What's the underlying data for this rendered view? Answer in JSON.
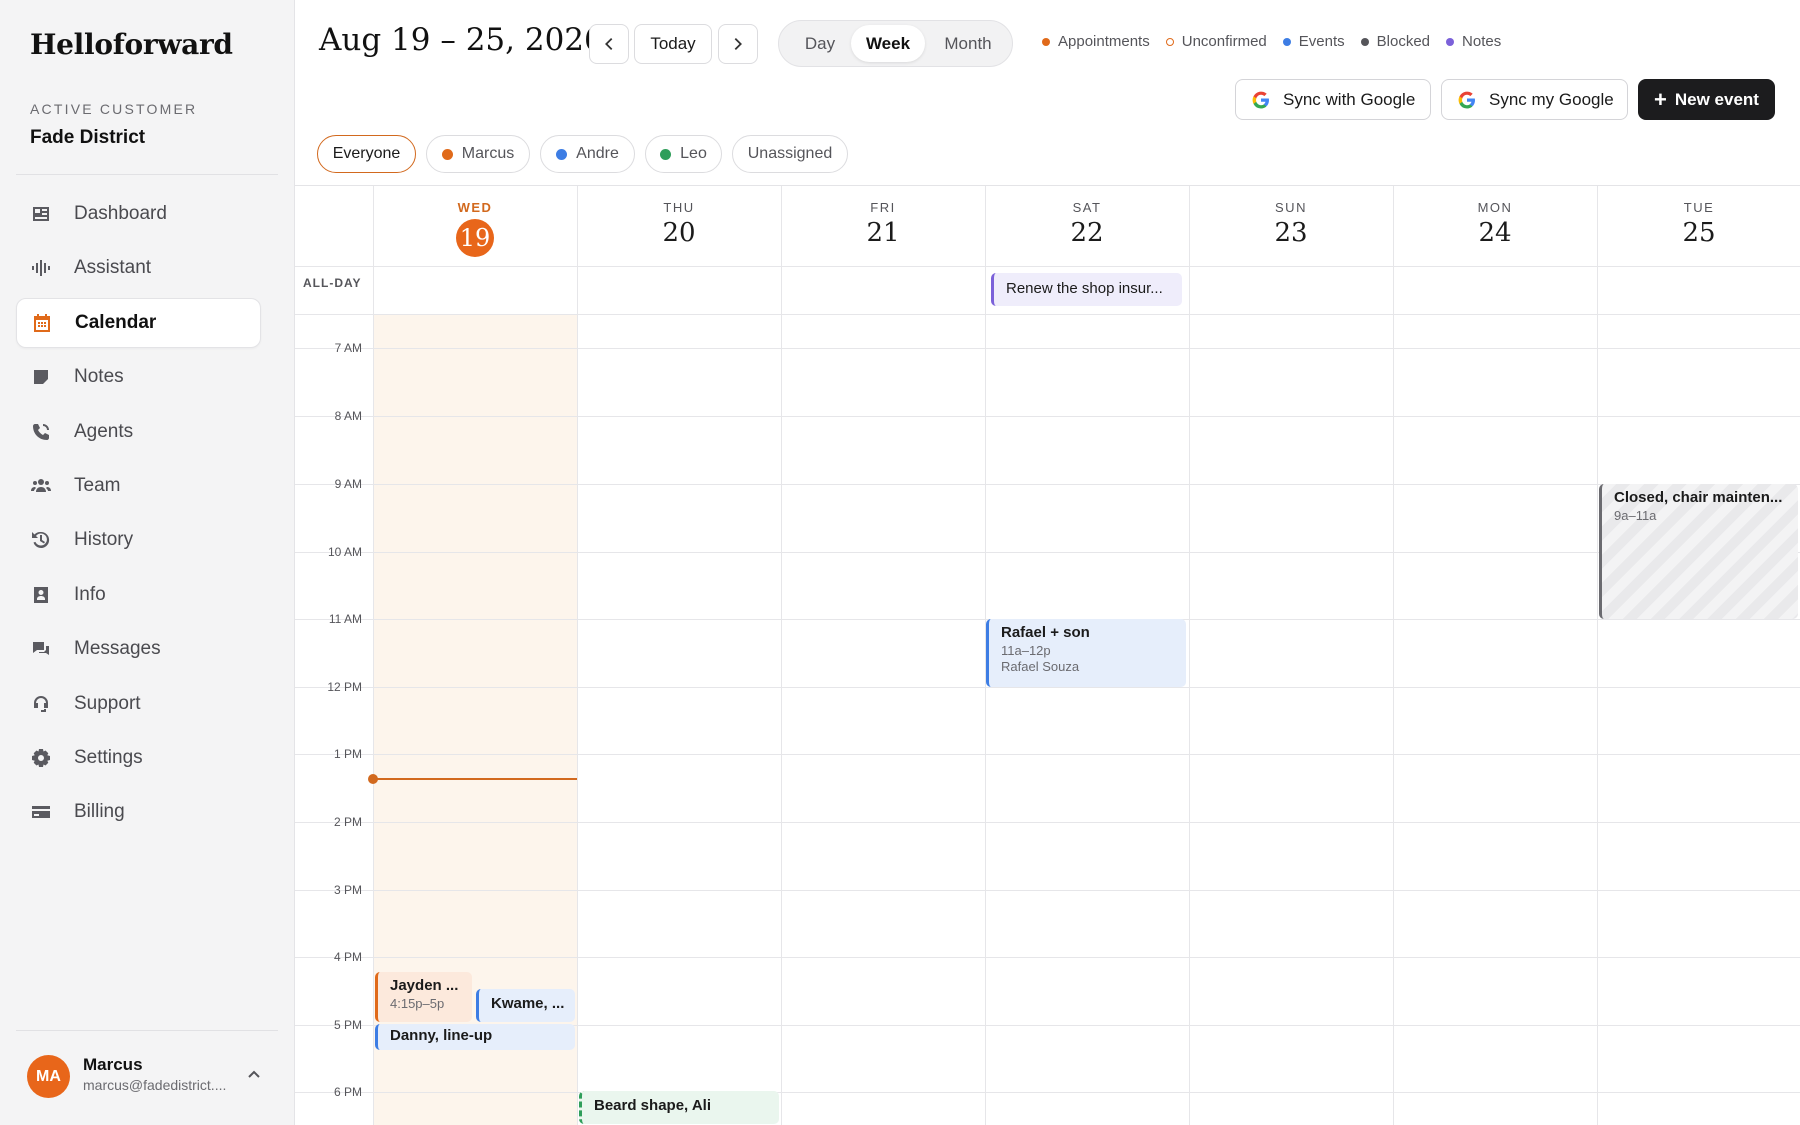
{
  "app": {
    "brand": "Helloforward"
  },
  "customer": {
    "label": "ACTIVE CUSTOMER",
    "name": "Fade District"
  },
  "sidebar": {
    "items": [
      {
        "label": "Dashboard",
        "icon": "dashboard-icon"
      },
      {
        "label": "Assistant",
        "icon": "waveform-icon"
      },
      {
        "label": "Calendar",
        "icon": "calendar-icon",
        "active": true
      },
      {
        "label": "Notes",
        "icon": "note-icon"
      },
      {
        "label": "Agents",
        "icon": "phone-icon"
      },
      {
        "label": "Team",
        "icon": "team-icon"
      },
      {
        "label": "History",
        "icon": "history-icon"
      },
      {
        "label": "Info",
        "icon": "contact-card-icon"
      },
      {
        "label": "Messages",
        "icon": "chat-icon"
      },
      {
        "label": "Support",
        "icon": "headset-icon"
      },
      {
        "label": "Settings",
        "icon": "gear-icon"
      },
      {
        "label": "Billing",
        "icon": "credit-card-icon"
      }
    ]
  },
  "user": {
    "initials": "MA",
    "name": "Marcus",
    "email": "marcus@fadedistrict...."
  },
  "header": {
    "date_range": "Aug 19 – 25, 2026",
    "today_label": "Today",
    "views": [
      "Day",
      "Week",
      "Month"
    ],
    "active_view": "Week",
    "legend": [
      {
        "label": "Appointments",
        "color": "#e06a1a",
        "style": "filled"
      },
      {
        "label": "Unconfirmed",
        "color": "#e06a1a",
        "style": "outline"
      },
      {
        "label": "Events",
        "color": "#3d7de4",
        "style": "filled"
      },
      {
        "label": "Blocked",
        "color": "#55555a",
        "style": "filled"
      },
      {
        "label": "Notes",
        "color": "#7b61d9",
        "style": "filled"
      }
    ],
    "sync_google_label": "Sync with Google",
    "sync_my_google_label": "Sync my Google",
    "new_event_label": "New event"
  },
  "filters": [
    {
      "label": "Everyone",
      "active": true
    },
    {
      "label": "Marcus",
      "color": "#e06a1a"
    },
    {
      "label": "Andre",
      "color": "#3d7de4"
    },
    {
      "label": "Leo",
      "color": "#2f9e5a"
    },
    {
      "label": "Unassigned"
    }
  ],
  "calendar": {
    "allday_label": "ALL-DAY",
    "days": [
      {
        "dow": "WED",
        "num": "19",
        "today": true
      },
      {
        "dow": "THU",
        "num": "20"
      },
      {
        "dow": "FRI",
        "num": "21"
      },
      {
        "dow": "SAT",
        "num": "22"
      },
      {
        "dow": "SUN",
        "num": "23"
      },
      {
        "dow": "MON",
        "num": "24"
      },
      {
        "dow": "TUE",
        "num": "25"
      }
    ],
    "hours": [
      "7 AM",
      "8 AM",
      "9 AM",
      "10 AM",
      "11 AM",
      "12 PM",
      "1 PM",
      "2 PM",
      "3 PM",
      "4 PM",
      "5 PM",
      "6 PM"
    ],
    "allday_events": [
      {
        "title": "Renew the shop insur...",
        "day": 3,
        "kind": "note"
      }
    ],
    "events": [
      {
        "title": "Closed, chair mainten...",
        "time": "9a–11a",
        "day": 6,
        "kind": "blocked"
      },
      {
        "title": "Rafael + son",
        "time": "11a–12p",
        "person": "Rafael Souza",
        "day": 3,
        "kind": "blue"
      },
      {
        "title": "Jayden ...",
        "time": "4:15p–5p",
        "day": 0,
        "kind": "orange"
      },
      {
        "title": "Kwame, ...",
        "day": 0,
        "kind": "blue"
      },
      {
        "title": "Danny, line-up",
        "day": 0,
        "kind": "blue"
      },
      {
        "title": "Beard shape, Ali",
        "day": 1,
        "kind": "green"
      }
    ]
  }
}
